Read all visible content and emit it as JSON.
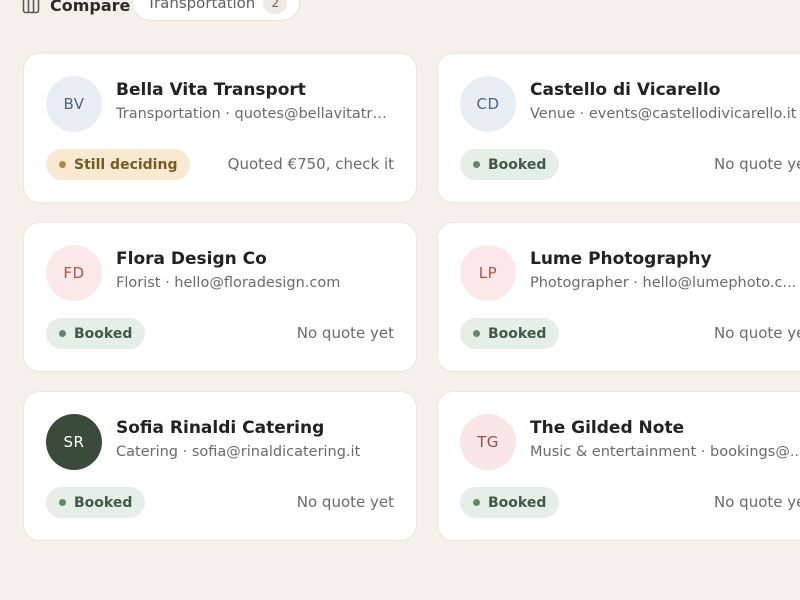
{
  "toolbar": {
    "compare_label": "Compare",
    "compare_icon": "columns-icon",
    "filter_label": "Transportation",
    "filter_count": "2"
  },
  "colors": {
    "page_bg": "#f5f1ea",
    "booked_bg": "#e6efe7",
    "booked_text": "#3f5a45",
    "deciding_bg": "#f8ead2",
    "deciding_text": "#7a5a22"
  },
  "vendors": [
    {
      "initials": "BV",
      "name": "Bella Vita Transport",
      "category": "Transportation",
      "email": "quotes@bellavitatr...",
      "meta": "Transportation · quotes@bellavitatransport.it",
      "status": "Still deciding",
      "status_type": "deciding",
      "quote": "Quoted €750, check it",
      "avatar_bg": "#e9eef5",
      "avatar_fg": "#4d6480"
    },
    {
      "initials": "CD",
      "name": "Castello di Vicarello",
      "category": "Venue",
      "meta": "Venue · events@castellodivicarello.it",
      "status": "Booked",
      "status_type": "booked",
      "quote": "No quote yet",
      "avatar_bg": "#e9eef5",
      "avatar_fg": "#4d6480"
    },
    {
      "initials": "FD",
      "name": "Flora Design Co",
      "category": "Florist",
      "meta": "Florist · hello@floradesign.com",
      "status": "Booked",
      "status_type": "booked",
      "quote": "No quote yet",
      "avatar_bg": "#fbe9e7",
      "avatar_fg": "#b0544a"
    },
    {
      "initials": "LP",
      "name": "Lume Photography",
      "category": "Photographer",
      "meta": "Photographer · hello@lumephoto.c...",
      "status": "Booked",
      "status_type": "booked",
      "quote": "No quote yet",
      "avatar_bg": "#fbe9e7",
      "avatar_fg": "#b0544a"
    },
    {
      "initials": "SR",
      "name": "Sofia Rinaldi Catering",
      "category": "Catering",
      "meta": "Catering · sofia@rinaldicatering.it",
      "status": "Booked",
      "status_type": "booked",
      "quote": "No quote yet",
      "avatar_bg": "#3a4a3b",
      "avatar_fg": "#ffffff"
    },
    {
      "initials": "TG",
      "name": "The Gilded Note",
      "category": "Music & entertainment",
      "meta": "Music & entertainment · bookings@...",
      "status": "Booked",
      "status_type": "booked",
      "quote": "No quote yet",
      "avatar_bg": "#f8e7e4",
      "avatar_fg": "#9c4f47"
    }
  ]
}
